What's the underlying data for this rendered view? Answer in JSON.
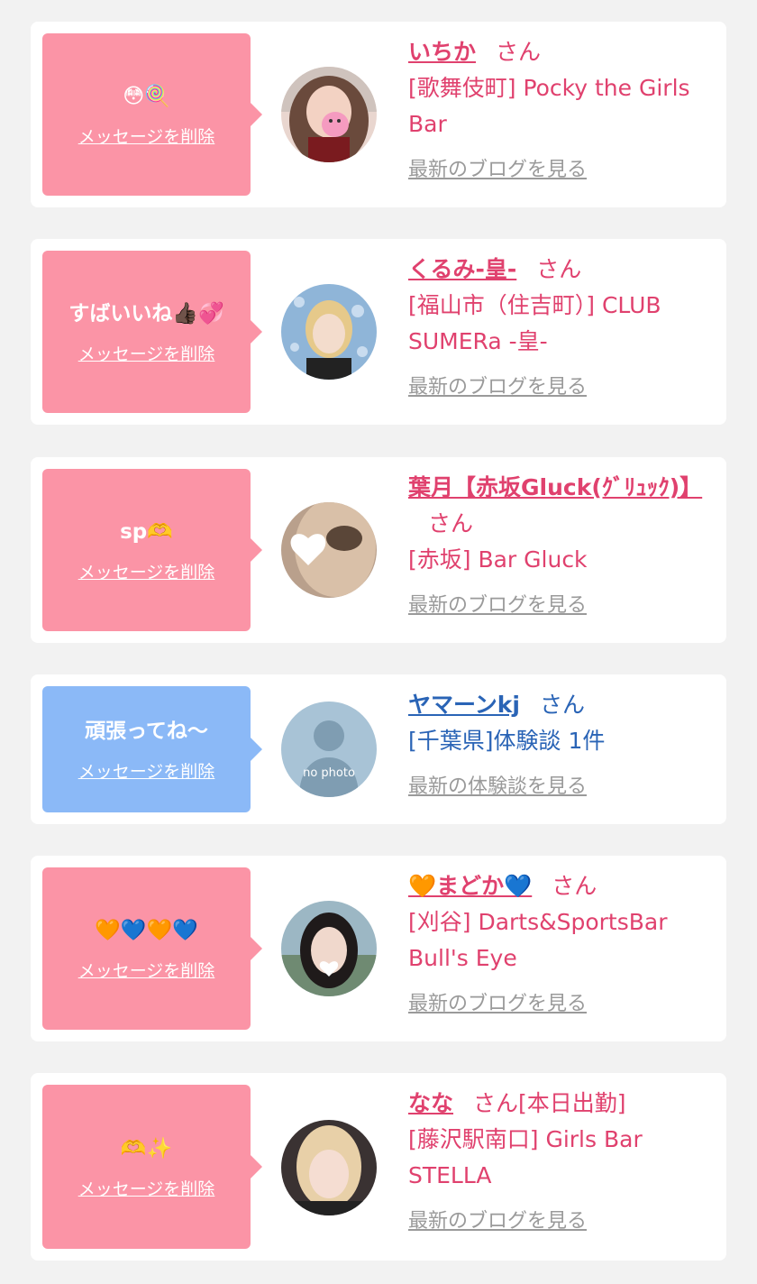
{
  "cards": [
    {
      "message": "😳🍭",
      "delete_label": "メッセージを削除",
      "name": "いちか",
      "honorific": "さん",
      "shop": "[歌舞伎町] Pocky the Girls Bar",
      "link": "最新のブログを見る",
      "theme": "pink"
    },
    {
      "message": "すばいいね👍🏿💞",
      "delete_label": "メッセージを削除",
      "name": "くるみ-皇-",
      "honorific": "さん",
      "shop": "[福山市（住吉町）] CLUB SUMERa -皇-",
      "link": "最新のブログを見る",
      "theme": "pink"
    },
    {
      "message": "sp🫶",
      "delete_label": "メッセージを削除",
      "name": "葉月【赤坂Gluck(ｸﾞﾘｭｯｸ)】",
      "honorific": "さん",
      "shop": "[赤坂] Bar Gluck",
      "link": "最新のブログを見る",
      "theme": "pink"
    },
    {
      "message": "頑張ってね〜",
      "delete_label": "メッセージを削除",
      "name": "ヤマーンkj",
      "honorific": "さん",
      "shop": "[千葉県]体験談 1件",
      "link": "最新の体験談を見る",
      "theme": "blue",
      "avatar_text": "no photo"
    },
    {
      "message": "🧡💙🧡💙",
      "delete_label": "メッセージを削除",
      "name": "🧡まどか💙",
      "honorific": "さん",
      "shop": "[刈谷] Darts&SportsBar Bull's Eye",
      "link": "最新のブログを見る",
      "theme": "pink"
    },
    {
      "message": "🫶✨",
      "delete_label": "メッセージを削除",
      "name": "なな",
      "honorific": "さん[本日出勤]",
      "shop": "[藤沢駅南口] Girls Bar STELLA",
      "link": "最新のブログを見る",
      "theme": "pink"
    }
  ],
  "colors": {
    "pink_bubble": "#fb94a6",
    "blue_bubble": "#8bb9f7",
    "pink_text": "#e0416e",
    "blue_text": "#2a64b6",
    "link_gray": "#9a9a9a",
    "background": "#f2f2f2"
  }
}
